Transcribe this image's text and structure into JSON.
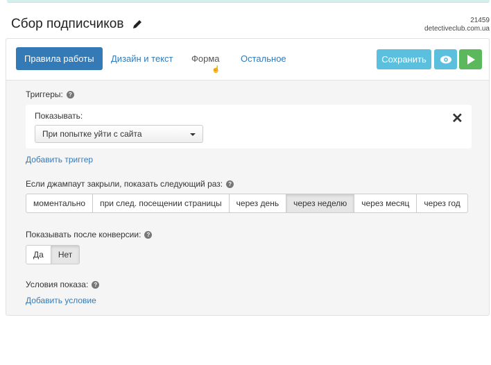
{
  "header": {
    "title": "Сбор подписчиков",
    "site_id": "21459",
    "site_domain": "detectiveclub.com.ua"
  },
  "tabs": [
    {
      "label": "Правила работы",
      "active": true
    },
    {
      "label": "Дизайн и текст",
      "active": false
    },
    {
      "label": "Форма",
      "active": false
    },
    {
      "label": "Остальное",
      "active": false
    }
  ],
  "toolbar": {
    "save_label": "Сохранить"
  },
  "triggers": {
    "label": "Триггеры:",
    "show_label": "Показывать:",
    "selected_trigger": "При попытке уйти с сайта",
    "add_trigger_link": "Добавить триггер"
  },
  "repeat": {
    "label": "Если джампаут закрыли, показать следующий раз:",
    "options": [
      "моментально",
      "при след. посещении страницы",
      "через день",
      "через неделю",
      "через месяц",
      "через год"
    ],
    "selected": "через неделю"
  },
  "after_conversion": {
    "label": "Показывать после конверсии:",
    "options": [
      "Да",
      "Нет"
    ],
    "selected": "Нет"
  },
  "conditions": {
    "label": "Условия показа:",
    "add_condition_link": "Добавить условие"
  },
  "colors": {
    "primary": "#337ab7",
    "info": "#5bc0de",
    "success": "#5cb85c"
  }
}
